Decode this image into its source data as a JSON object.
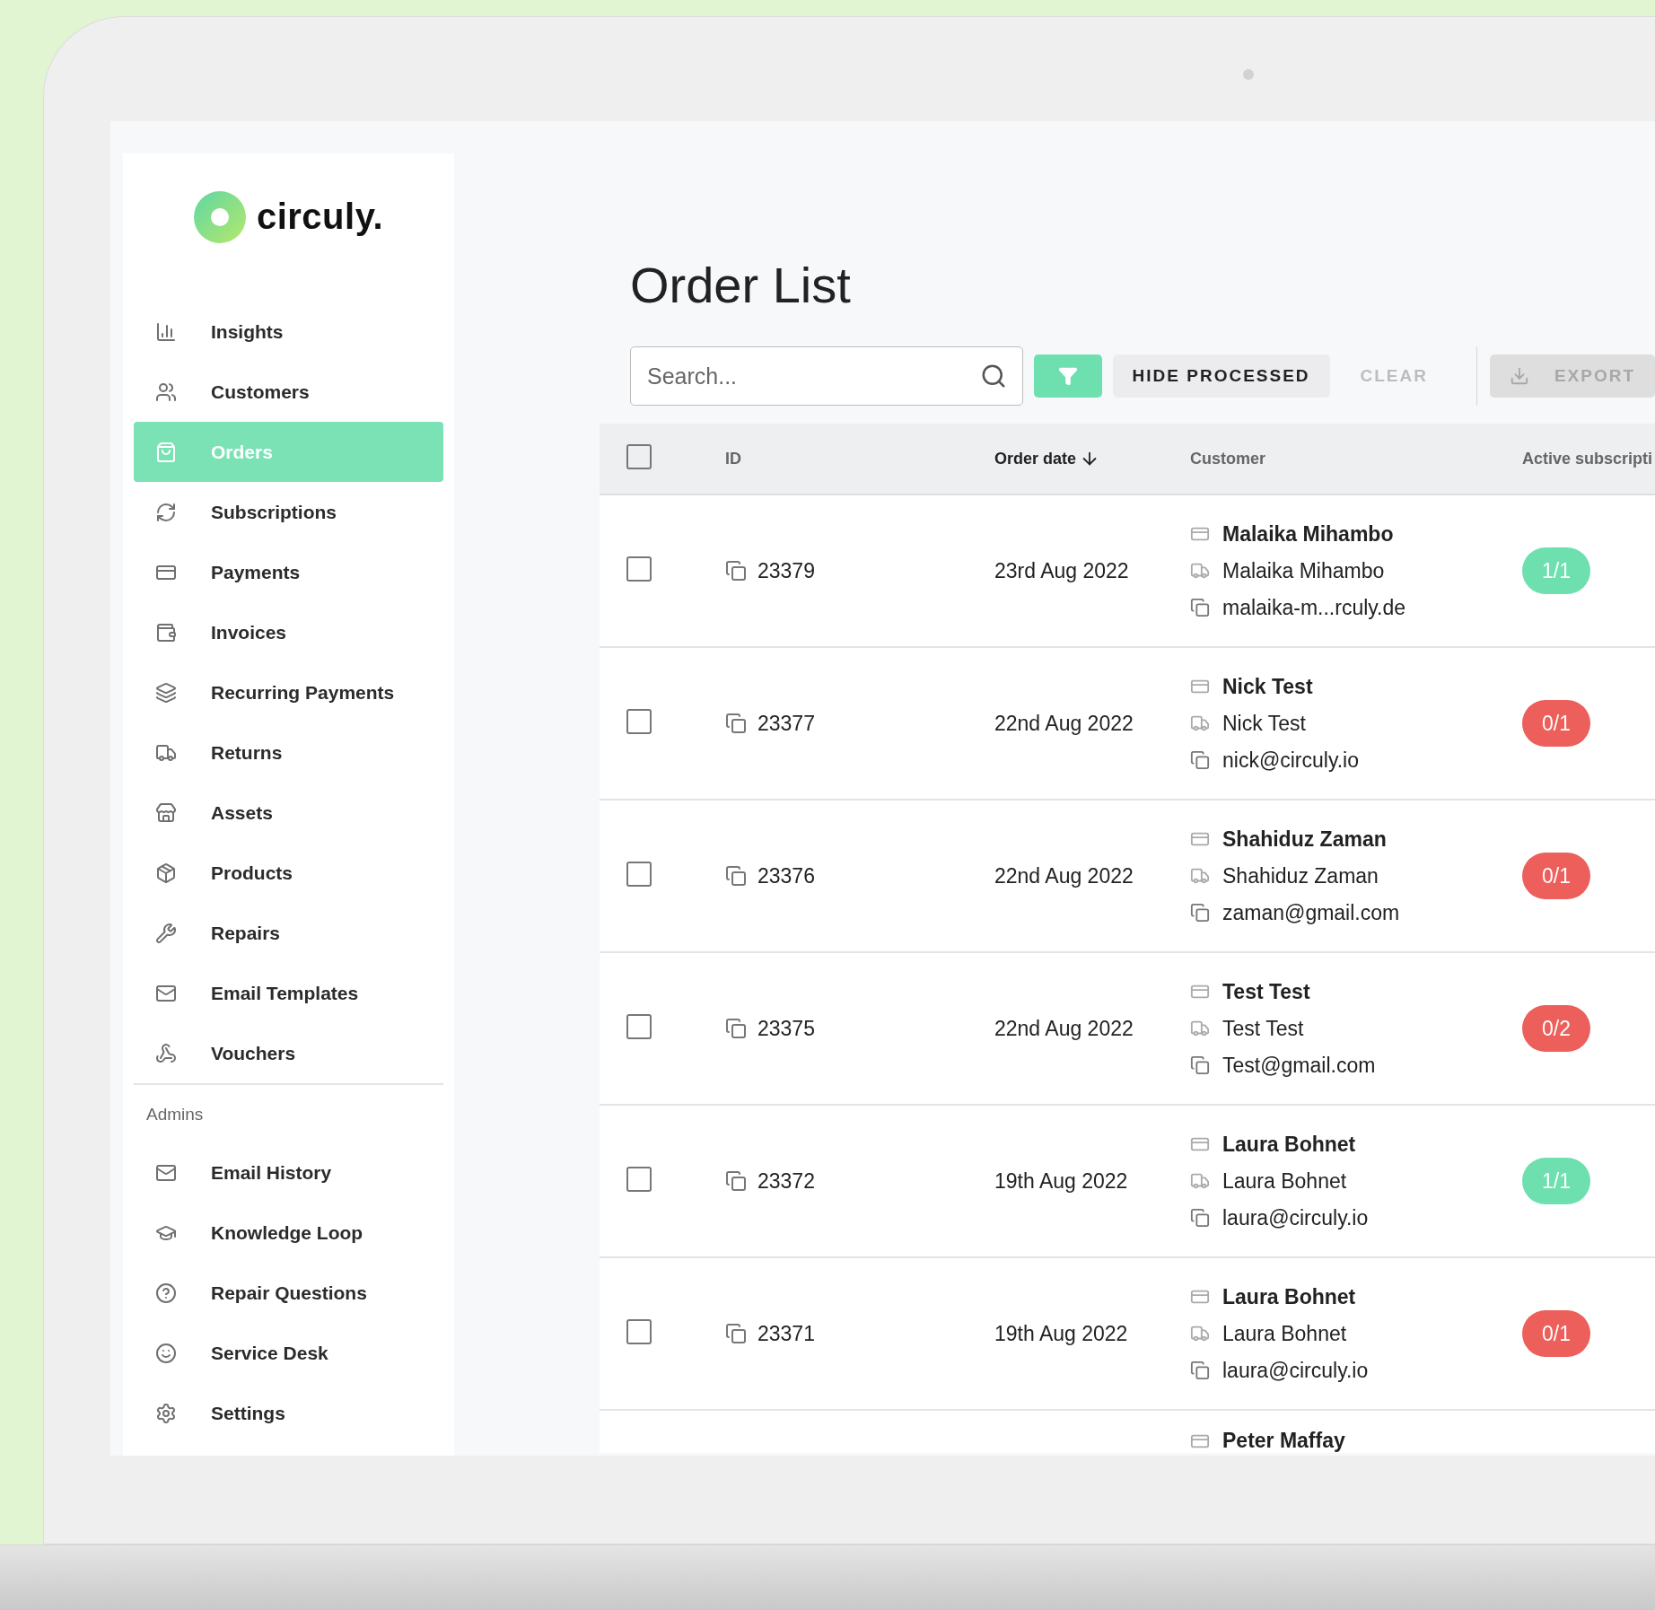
{
  "logo": {
    "text": "circuly."
  },
  "sidebar": {
    "items": [
      {
        "label": "Insights",
        "selected": false
      },
      {
        "label": "Customers",
        "selected": false
      },
      {
        "label": "Orders",
        "selected": true
      },
      {
        "label": "Subscriptions",
        "selected": false
      },
      {
        "label": "Payments",
        "selected": false
      },
      {
        "label": "Invoices",
        "selected": false
      },
      {
        "label": "Recurring Payments",
        "selected": false
      },
      {
        "label": "Returns",
        "selected": false
      },
      {
        "label": "Assets",
        "selected": false
      },
      {
        "label": "Products",
        "selected": false
      },
      {
        "label": "Repairs",
        "selected": false
      },
      {
        "label": "Email Templates",
        "selected": false
      },
      {
        "label": "Vouchers",
        "selected": false
      }
    ],
    "section_title": "Admins",
    "admin_items": [
      {
        "label": "Email History",
        "selected": false
      },
      {
        "label": "Knowledge Loop",
        "selected": false
      },
      {
        "label": "Repair Questions",
        "selected": false
      },
      {
        "label": "Service Desk",
        "selected": false
      },
      {
        "label": "Settings",
        "selected": false
      }
    ]
  },
  "page_title": "Order List",
  "toolbar": {
    "search": {
      "placeholder": "Search..."
    },
    "hide_processed": "HIDE PROCESSED",
    "clear": "CLEAR",
    "export": "EXPORT"
  },
  "table": {
    "select_all": {
      "checked": false
    },
    "columns": [
      {
        "label": "ID",
        "sorted": false
      },
      {
        "label": "Order date",
        "sorted": true
      },
      {
        "label": "Customer",
        "sorted": false
      },
      {
        "label": "Active subscripti",
        "sorted": false
      }
    ],
    "rows": [
      {
        "checked": false,
        "id": "23379",
        "date": "23rd Aug 2022",
        "billing_name": "Malaika Mihambo",
        "shipping_name": "Malaika Mihambo",
        "email": "malaika-m...rculy.de",
        "subscriptions": "1/1",
        "color": "#6ee0b0"
      },
      {
        "checked": false,
        "id": "23377",
        "date": "22nd Aug 2022",
        "billing_name": "Nick Test",
        "shipping_name": "Nick Test",
        "email": "nick@circuly.io",
        "subscriptions": "0/1",
        "color": "#ec5f5b"
      },
      {
        "checked": false,
        "id": "23376",
        "date": "22nd Aug 2022",
        "billing_name": "Shahiduz Zaman",
        "shipping_name": "Shahiduz Zaman",
        "email": "zaman@gmail.com",
        "subscriptions": "0/1",
        "color": "#ec5f5b"
      },
      {
        "checked": false,
        "id": "23375",
        "date": "22nd Aug 2022",
        "billing_name": "Test Test",
        "shipping_name": "Test Test",
        "email": "Test@gmail.com",
        "subscriptions": "0/2",
        "color": "#ec5f5b"
      },
      {
        "checked": false,
        "id": "23372",
        "date": "19th Aug 2022",
        "billing_name": "Laura Bohnet",
        "shipping_name": "Laura Bohnet",
        "email": "laura@circuly.io",
        "subscriptions": "1/1",
        "color": "#6ee0b0"
      },
      {
        "checked": false,
        "id": "23371",
        "date": "19th Aug 2022",
        "billing_name": "Laura Bohnet",
        "shipping_name": "Laura Bohnet",
        "email": "laura@circuly.io",
        "subscriptions": "0/1",
        "color": "#ec5f5b"
      },
      {
        "billing_name": "Peter Maffay"
      }
    ]
  }
}
